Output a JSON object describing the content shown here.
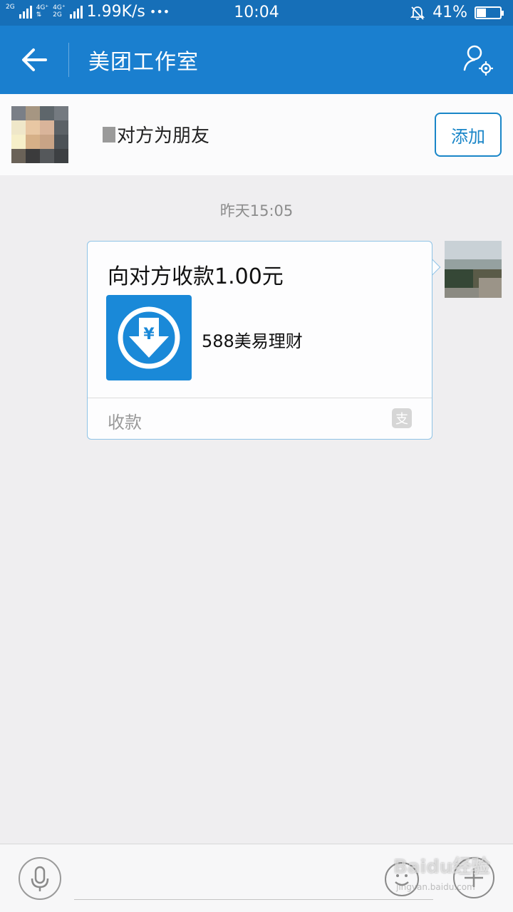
{
  "status_bar": {
    "network_top": "2G",
    "network_mid_a": "4G⁺",
    "network_mid_b": "4G⁺",
    "network_mid_c": "2G",
    "speed": "1.99K/s",
    "dots": "•••",
    "time": "10:04",
    "battery": "41%",
    "battery_level": 0.41
  },
  "nav": {
    "back_icon": "back-arrow-icon",
    "title": "美团工作室",
    "settings_icon": "profile-settings-icon"
  },
  "friend_bar": {
    "prompt": "对方为朋友",
    "add_label": "添加"
  },
  "chat": {
    "timestamp": "昨天15:05",
    "message": {
      "title": "向对方收款1.00元",
      "app_name": "588美易理财",
      "footer_label": "收款",
      "footer_icon_glyph": "支"
    }
  },
  "input_bar": {
    "mic_icon": "microphone-icon",
    "emoji_icon": "emoji-icon",
    "plus_icon": "plus-icon"
  },
  "watermark": {
    "text": "Baidu经验",
    "sub": "jingyan.baidu.com"
  },
  "colors": {
    "status_bar": "#166fb8",
    "nav_bar": "#1a7fcf",
    "accent": "#1a86c8",
    "app_icon": "#1a89d8",
    "background": "#efeef0"
  }
}
